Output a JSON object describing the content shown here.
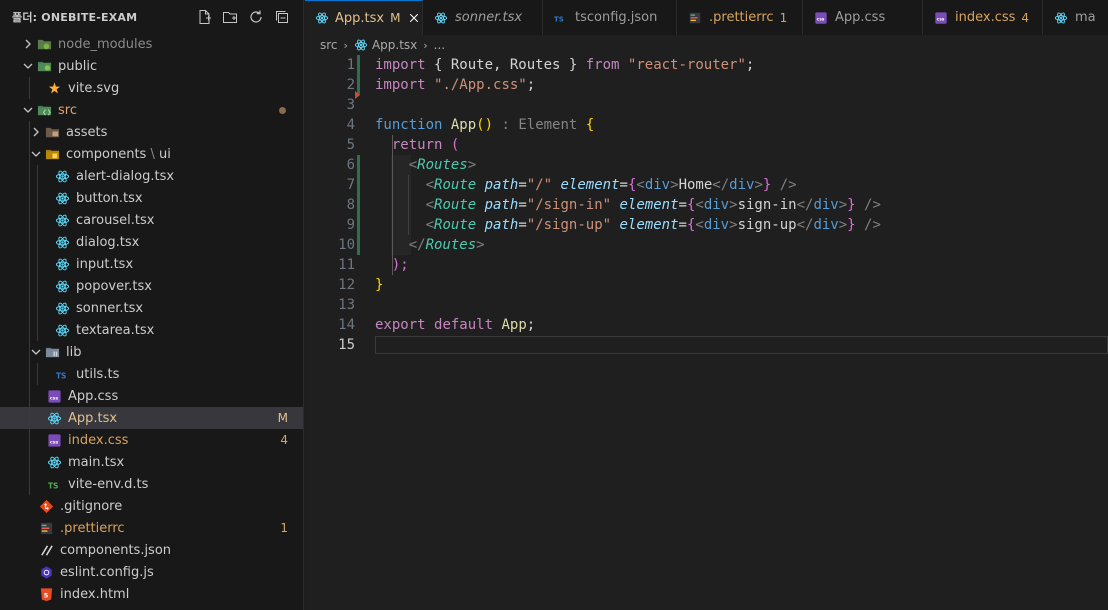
{
  "explorer": {
    "title": "폴더: ONEBITE-EXAM",
    "actions": [
      "new-file-icon",
      "new-folder-icon",
      "refresh-icon",
      "collapse-all-icon"
    ],
    "items": [
      {
        "label": "node_modules",
        "badge": "",
        "status": "dim"
      },
      {
        "label": "public",
        "badge": "",
        "status": ""
      },
      {
        "label": "vite.svg",
        "badge": "",
        "status": ""
      },
      {
        "label": "src",
        "badge": "●",
        "status": "orange"
      },
      {
        "label": "assets",
        "badge": "",
        "status": ""
      },
      {
        "label": "components",
        "label2": "ui",
        "badge": "",
        "status": ""
      },
      {
        "label": "alert-dialog.tsx",
        "badge": "",
        "status": ""
      },
      {
        "label": "button.tsx",
        "badge": "",
        "status": ""
      },
      {
        "label": "carousel.tsx",
        "badge": "",
        "status": ""
      },
      {
        "label": "dialog.tsx",
        "badge": "",
        "status": ""
      },
      {
        "label": "input.tsx",
        "badge": "",
        "status": ""
      },
      {
        "label": "popover.tsx",
        "badge": "",
        "status": ""
      },
      {
        "label": "sonner.tsx",
        "badge": "",
        "status": ""
      },
      {
        "label": "textarea.tsx",
        "badge": "",
        "status": ""
      },
      {
        "label": "lib",
        "badge": "",
        "status": ""
      },
      {
        "label": "utils.ts",
        "badge": "",
        "status": ""
      },
      {
        "label": "App.css",
        "badge": "",
        "status": ""
      },
      {
        "label": "App.tsx",
        "badge": "M",
        "status": "modified"
      },
      {
        "label": "index.css",
        "badge": "4",
        "status": "warning"
      },
      {
        "label": "main.tsx",
        "badge": "",
        "status": ""
      },
      {
        "label": "vite-env.d.ts",
        "badge": "",
        "status": ""
      },
      {
        "label": ".gitignore",
        "badge": "",
        "status": ""
      },
      {
        "label": ".prettierrc",
        "badge": "1",
        "status": "warning"
      },
      {
        "label": "components.json",
        "badge": "",
        "status": ""
      },
      {
        "label": "eslint.config.js",
        "badge": "",
        "status": ""
      },
      {
        "label": "index.html",
        "badge": "",
        "status": ""
      }
    ]
  },
  "tabs": [
    {
      "label": "App.tsx",
      "status": "M",
      "active": true
    },
    {
      "label": "sonner.tsx",
      "status": "",
      "active": false
    },
    {
      "label": "tsconfig.json",
      "status": "",
      "active": false
    },
    {
      "label": ".prettierrc",
      "status": "1",
      "active": false
    },
    {
      "label": "App.css",
      "status": "",
      "active": false
    },
    {
      "label": "index.css",
      "status": "4",
      "active": false
    },
    {
      "label": "ma",
      "status": "",
      "active": false
    }
  ],
  "breadcrumb": [
    "src",
    "App.tsx",
    "..."
  ],
  "editor": {
    "line_numbers": [
      "1",
      "2",
      "3",
      "4",
      "5",
      "6",
      "7",
      "8",
      "9",
      "10",
      "11",
      "12",
      "13",
      "14",
      "15"
    ],
    "current_line": "15",
    "code": [
      "import { Route, Routes } from \"react-router\";",
      "import \"./App.css\";",
      "",
      "function App() : Element {",
      "  return (",
      "    <Routes>",
      "      <Route path=\"/\" element={<div>Home</div>} />",
      "      <Route path=\"/sign-in\" element={<div>sign-in</div>} />",
      "      <Route path=\"/sign-up\" element={<div>sign-up</div>} />",
      "    </Routes>",
      "  );",
      "}",
      "",
      "export default App;",
      ""
    ]
  },
  "tokens": {
    "import": "import",
    "from": "from",
    "function": "function",
    "return": "return",
    "export": "export",
    "default": "default",
    "route_brace": "{ Route, Routes }",
    "react_router": "\"react-router\"",
    "app_css": "\"./App.css\"",
    "app": "App",
    "parens": "()",
    "type_colon": ":",
    "element_type": "Element",
    "open_brace": "{",
    "close_brace": "}",
    "open_paren": "(",
    "close_paren_semi": ");",
    "semicolon": ";",
    "routes": "Routes",
    "route": "Route",
    "path": "path",
    "element": "element",
    "div": "div",
    "lt": "<",
    "lt_slash": "</",
    "gt": ">",
    "self_close": "/>",
    "eq": "=",
    "path_root": "\"/\"",
    "path_signin": "\"/sign-in\"",
    "path_signup": "\"/sign-up\"",
    "home": "Home",
    "signin": "sign-in",
    "signup": "sign-up"
  },
  "colors": {
    "accent": "#0078d4",
    "modified": "#e2c08d",
    "warning": "#d7a35e",
    "keyword": "#c586c0",
    "string": "#ce9178",
    "function": "#dcdcaa",
    "tag": "#4ec9b0",
    "attribute": "#9cdcfe"
  }
}
